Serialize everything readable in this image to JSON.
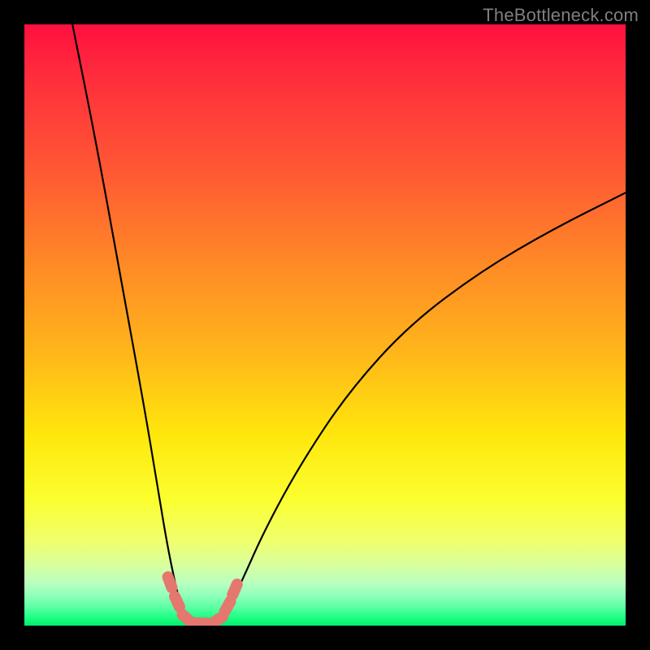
{
  "watermark": "TheBottleneck.com",
  "colors": {
    "frame": "#000000",
    "curve": "#000000",
    "markers": "#e4776e",
    "gradient_top": "#ff103f",
    "gradient_bottom": "#00f06a"
  },
  "chart_data": {
    "type": "line",
    "title": "",
    "xlabel": "",
    "ylabel": "",
    "xlim": [
      0,
      100
    ],
    "ylim": [
      0,
      100
    ],
    "grid": false,
    "legend": false,
    "description": "V-shaped bottleneck curve plotted over a vertical red→yellow→green gradient. Lower y is better (green zone). The minimum (≈0) occurs near x≈27–33. Left branch starts near y≈100 at x≈8 and drops steeply; right branch rises with diminishing slope toward y≈72 at x=100.",
    "series": [
      {
        "name": "left_branch",
        "x": [
          8,
          12,
          16,
          20,
          22,
          24,
          26,
          27
        ],
        "values": [
          100,
          80,
          58,
          36,
          24,
          12,
          3,
          1
        ]
      },
      {
        "name": "floor",
        "x": [
          27,
          28,
          30,
          32,
          33
        ],
        "values": [
          1,
          0.3,
          0,
          0.3,
          1
        ]
      },
      {
        "name": "right_branch",
        "x": [
          33,
          36,
          40,
          46,
          54,
          64,
          76,
          88,
          100
        ],
        "values": [
          1,
          7,
          16,
          27,
          39,
          50,
          59,
          66,
          72
        ]
      }
    ],
    "markers": {
      "note": "Pink lozenge-shaped markers clustered at the curve's trough",
      "points": [
        {
          "x": 24.2,
          "y": 7.2
        },
        {
          "x": 25.4,
          "y": 4.0
        },
        {
          "x": 27.0,
          "y": 1.2
        },
        {
          "x": 29.5,
          "y": 0.4
        },
        {
          "x": 32.2,
          "y": 1.0
        },
        {
          "x": 33.8,
          "y": 3.2
        },
        {
          "x": 35.0,
          "y": 6.0
        }
      ]
    }
  }
}
